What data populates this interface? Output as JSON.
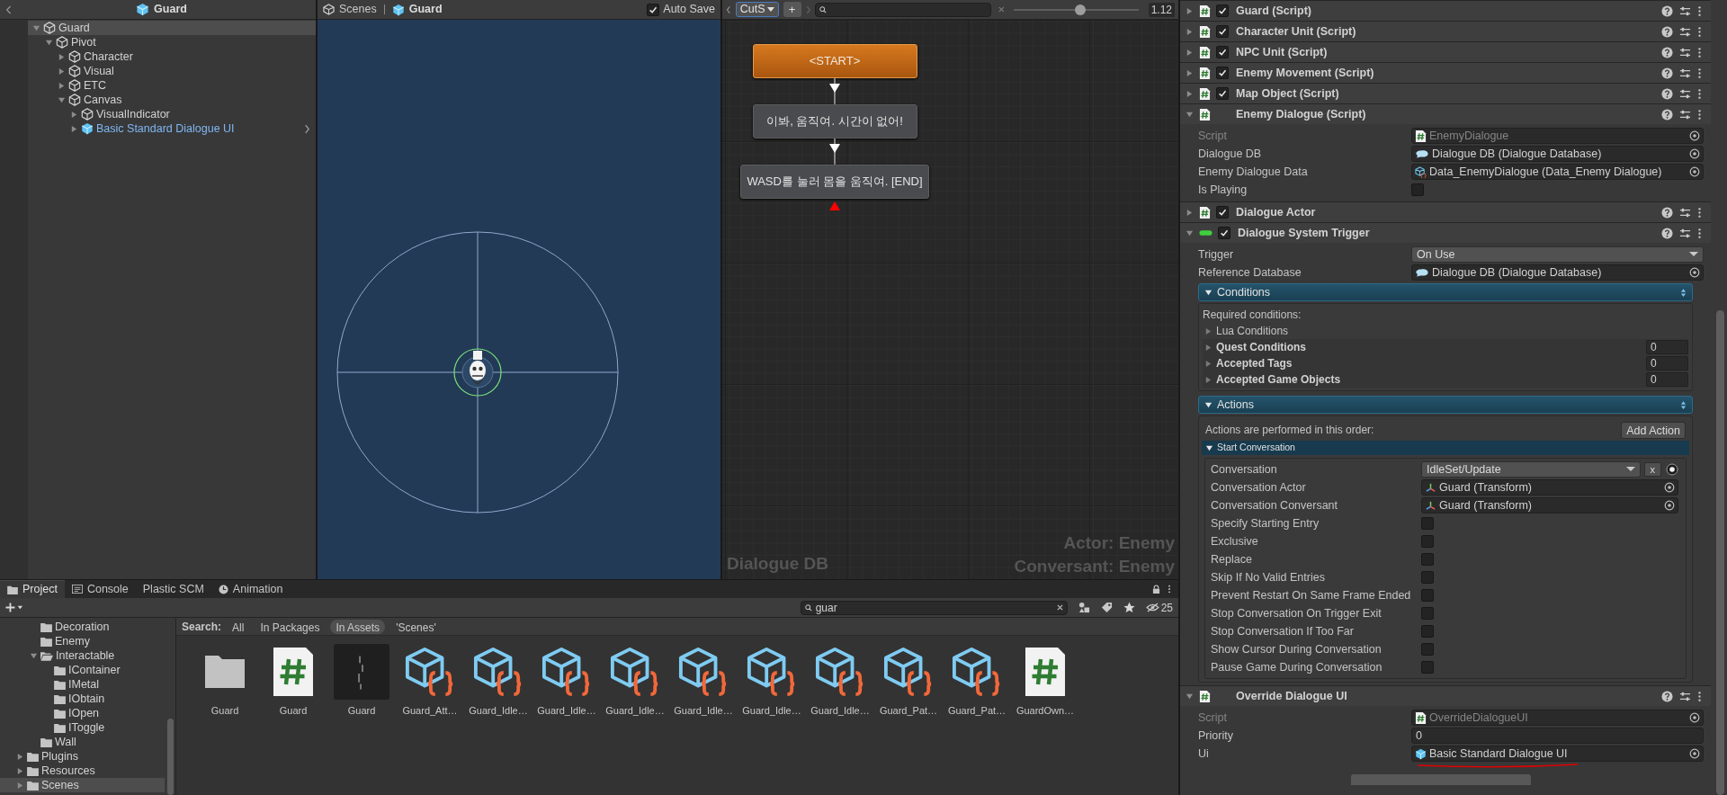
{
  "hierarchy": {
    "title": "Guard",
    "items": [
      {
        "label": "Guard",
        "expanded": true,
        "selected": true,
        "prefab": false,
        "children": [
          {
            "label": "Pivot",
            "expanded": true,
            "selected": false,
            "prefab": false,
            "children": [
              {
                "label": "Character",
                "expanded": false,
                "selected": false,
                "prefab": false
              },
              {
                "label": "Visual",
                "expanded": false,
                "selected": false,
                "prefab": false
              },
              {
                "label": "ETC",
                "expanded": false,
                "selected": false,
                "prefab": false
              },
              {
                "label": "Canvas",
                "expanded": true,
                "selected": false,
                "prefab": false,
                "children": [
                  {
                    "label": "VisualIndicator",
                    "expanded": false,
                    "selected": false,
                    "prefab": false
                  },
                  {
                    "label": "Basic Standard Dialogue UI",
                    "expanded": false,
                    "selected": false,
                    "prefab": true
                  }
                ]
              }
            ]
          }
        ]
      }
    ]
  },
  "scene": {
    "breadcrumb": "Scenes",
    "prefab": "Guard",
    "auto_save": {
      "label": "Auto Save",
      "checked": true
    }
  },
  "dialogue_editor": {
    "conversation_menu": "CutS",
    "add_button": "+",
    "zoom": {
      "level": 0.53,
      "reading": "1.12"
    },
    "nodes": [
      {
        "kind": "start",
        "text": "<START>",
        "dead_end": false
      },
      {
        "kind": "entry",
        "text": "이봐, 움직여. 시간이 없어!",
        "dead_end": false
      },
      {
        "kind": "entry",
        "text": "WASD를 눌러 몸을 움직여. [END]",
        "dead_end": true
      }
    ],
    "database_label": "Dialogue DB",
    "actor_label": "Actor: Enemy",
    "conversant_label": "Conversant: Enemy"
  },
  "inspector": {
    "components": [
      {
        "name": "Guard (Script)",
        "kind": "script",
        "enabled": true,
        "expanded": false
      },
      {
        "name": "Character Unit (Script)",
        "kind": "script",
        "enabled": true,
        "expanded": false
      },
      {
        "name": "NPC Unit (Script)",
        "kind": "script",
        "enabled": true,
        "expanded": false
      },
      {
        "name": "Enemy Movement (Script)",
        "kind": "script",
        "enabled": true,
        "expanded": false
      },
      {
        "name": "Map Object (Script)",
        "kind": "script",
        "enabled": true,
        "expanded": false
      },
      {
        "name": "Enemy Dialogue (Script)",
        "kind": "script",
        "expanded": true,
        "fields": [
          {
            "kind": "script_object",
            "label": "Script",
            "value": "EnemyDialogue",
            "disabled": true,
            "underlined": false
          },
          {
            "kind": "database_object",
            "label": "Dialogue DB",
            "value": "Dialogue DB (Dialogue Database)",
            "disabled": false,
            "underlined": false
          },
          {
            "kind": "asset_object",
            "label": "Enemy Dialogue Data",
            "value": "Data_EnemyDialogue (Data_Enemy Dialogue)",
            "disabled": false,
            "underlined": false
          },
          {
            "kind": "checkbox",
            "label": "Is Playing",
            "checked": false
          }
        ]
      },
      {
        "name": "Dialogue Actor",
        "kind": "script",
        "enabled": true,
        "expanded": false
      },
      {
        "name": "Dialogue System Trigger",
        "kind": "trigger",
        "enabled": true,
        "expanded": true,
        "fields": [
          {
            "kind": "dropdown",
            "label": "Trigger",
            "value": "On Use"
          },
          {
            "kind": "database_object",
            "label": "Reference Database",
            "value": "Dialogue DB (Dialogue Database)",
            "disabled": false,
            "underlined": false
          }
        ],
        "conditions": {
          "title": "Conditions",
          "expanded": true,
          "intro": "Required conditions:",
          "items": [
            {
              "kind": "foldout",
              "label": "Lua Conditions",
              "expanded": false
            },
            {
              "kind": "list",
              "label": "Quest Conditions",
              "expanded": false,
              "count": "0"
            },
            {
              "kind": "list",
              "label": "Accepted Tags",
              "expanded": false,
              "count": "0"
            },
            {
              "kind": "list",
              "label": "Accepted Game Objects",
              "expanded": false,
              "count": "0"
            }
          ]
        },
        "actions": {
          "title": "Actions",
          "expanded": true,
          "intro": "Actions are performed in this order:",
          "add_button": "Add Action",
          "action": {
            "title": "Start Conversation",
            "expanded": true,
            "fields": [
              {
                "kind": "dropdown",
                "label": "Conversation",
                "value": "IdleSet/Update",
                "clear_button": "x"
              },
              {
                "kind": "transform_object",
                "label": "Conversation Actor",
                "value": "Guard (Transform)",
                "disabled": false,
                "underlined": false
              },
              {
                "kind": "transform_object",
                "label": "Conversation Conversant",
                "value": "Guard (Transform)",
                "disabled": false,
                "underlined": false
              },
              {
                "kind": "checkbox",
                "label": "Specify Starting Entry",
                "checked": false
              },
              {
                "kind": "checkbox",
                "label": "Exclusive",
                "checked": false
              },
              {
                "kind": "checkbox",
                "label": "Replace",
                "checked": false
              },
              {
                "kind": "checkbox",
                "label": "Skip If No Valid Entries",
                "checked": false
              },
              {
                "kind": "checkbox",
                "label": "Prevent Restart On Same Frame Ended",
                "checked": false
              },
              {
                "kind": "checkbox",
                "label": "Stop Conversation On Trigger Exit",
                "checked": false
              },
              {
                "kind": "checkbox",
                "label": "Stop Conversation If Too Far",
                "checked": false
              },
              {
                "kind": "checkbox",
                "label": "Show Cursor During Conversation",
                "checked": false
              },
              {
                "kind": "checkbox",
                "label": "Pause Game During Conversation",
                "checked": false
              }
            ]
          }
        }
      },
      {
        "name": "Override Dialogue UI",
        "kind": "script",
        "expanded": true,
        "fields": [
          {
            "kind": "script_object",
            "label": "Script",
            "value": "OverrideDialogueUI",
            "disabled": true,
            "underlined": false
          },
          {
            "kind": "text",
            "label": "Priority",
            "value": "0"
          },
          {
            "kind": "prefab_object",
            "label": "Ui",
            "value": "Basic Standard Dialogue UI",
            "disabled": false,
            "underlined": true
          }
        ]
      }
    ]
  },
  "project": {
    "tabs": [
      {
        "label": "Project",
        "kind": "folder",
        "selected": true
      },
      {
        "label": "Console",
        "kind": "console",
        "selected": false
      },
      {
        "label": "Plastic SCM",
        "kind": "none",
        "selected": false
      },
      {
        "label": "Animation",
        "kind": "animation",
        "selected": false
      }
    ],
    "search": {
      "value": "guar"
    },
    "hidden_count": "25",
    "scope": {
      "label": "Search:",
      "options": [
        {
          "label": "All",
          "selected": false
        },
        {
          "label": "In Packages",
          "selected": false
        },
        {
          "label": "In Assets",
          "selected": true
        },
        {
          "label": "'Scenes'",
          "selected": false
        }
      ]
    },
    "folders": [
      {
        "children": [
          {
            "label": "Decoration",
            "selected": false
          },
          {
            "label": "Enemy",
            "selected": false
          },
          {
            "label": "Interactable",
            "expanded": true,
            "selected": false,
            "children": [
              {
                "label": "IContainer",
                "selected": false
              },
              {
                "label": "IMetal",
                "selected": false
              },
              {
                "label": "IObtain",
                "selected": false
              },
              {
                "label": "IOpen",
                "selected": false
              },
              {
                "label": "IToggle",
                "selected": false
              }
            ]
          },
          {
            "label": "Wall",
            "selected": false
          }
        ]
      },
      {
        "label": "Plugins",
        "expanded": false,
        "selected": false
      },
      {
        "label": "Resources",
        "expanded": false,
        "selected": false
      },
      {
        "label": "Scenes",
        "expanded": false,
        "selected": true
      }
    ],
    "assets": [
      {
        "kind": "folder",
        "name": "Guard"
      },
      {
        "kind": "script",
        "name": "Guard"
      },
      {
        "kind": "image",
        "name": "Guard"
      },
      {
        "kind": "asset",
        "name": "Guard_Att…"
      },
      {
        "kind": "asset",
        "name": "Guard_Idle…"
      },
      {
        "kind": "asset",
        "name": "Guard_Idle…"
      },
      {
        "kind": "asset",
        "name": "Guard_Idle…"
      },
      {
        "kind": "asset",
        "name": "Guard_Idle…"
      },
      {
        "kind": "asset",
        "name": "Guard_Idle…"
      },
      {
        "kind": "asset",
        "name": "Guard_Idle…"
      },
      {
        "kind": "asset",
        "name": "Guard_Pat…"
      },
      {
        "kind": "asset",
        "name": "Guard_Pat…"
      },
      {
        "kind": "script",
        "name": "GuardOwn…"
      }
    ]
  }
}
